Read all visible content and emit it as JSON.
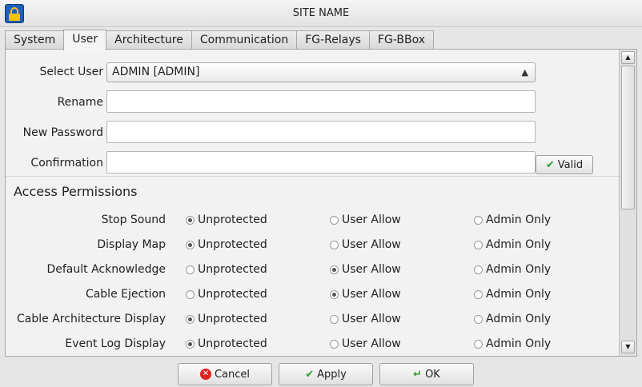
{
  "window": {
    "title": "SITE NAME",
    "icon": "lock-icon"
  },
  "tabs": [
    {
      "label": "System",
      "active": false
    },
    {
      "label": "User",
      "active": true
    },
    {
      "label": "Architecture",
      "active": false
    },
    {
      "label": "Communication",
      "active": false
    },
    {
      "label": "FG-Relays",
      "active": false
    },
    {
      "label": "FG-BBox",
      "active": false
    }
  ],
  "form": {
    "select_user_label": "Select User",
    "select_user_value": "ADMIN [ADMIN]",
    "rename_label": "Rename",
    "rename_value": "",
    "new_password_label": "New Password",
    "new_password_value": "",
    "confirmation_label": "Confirmation",
    "confirmation_value": "",
    "valid_button": "Valid"
  },
  "permissions": {
    "title": "Access Permissions",
    "options": [
      "Unprotected",
      "User Allow",
      "Admin Only"
    ],
    "rows": [
      {
        "label": "Stop Sound",
        "selected": "Unprotected"
      },
      {
        "label": "Display Map",
        "selected": "Unprotected"
      },
      {
        "label": "Default Acknowledge",
        "selected": "User Allow"
      },
      {
        "label": "Cable Ejection",
        "selected": "User Allow"
      },
      {
        "label": "Cable Architecture Display",
        "selected": "Unprotected"
      },
      {
        "label": "Event Log Display",
        "selected": "Unprotected"
      }
    ]
  },
  "footer": {
    "cancel": "Cancel",
    "apply": "Apply",
    "ok": "OK"
  },
  "colors": {
    "accent_green": "#2ea12e",
    "cancel_red": "#dd2222"
  }
}
